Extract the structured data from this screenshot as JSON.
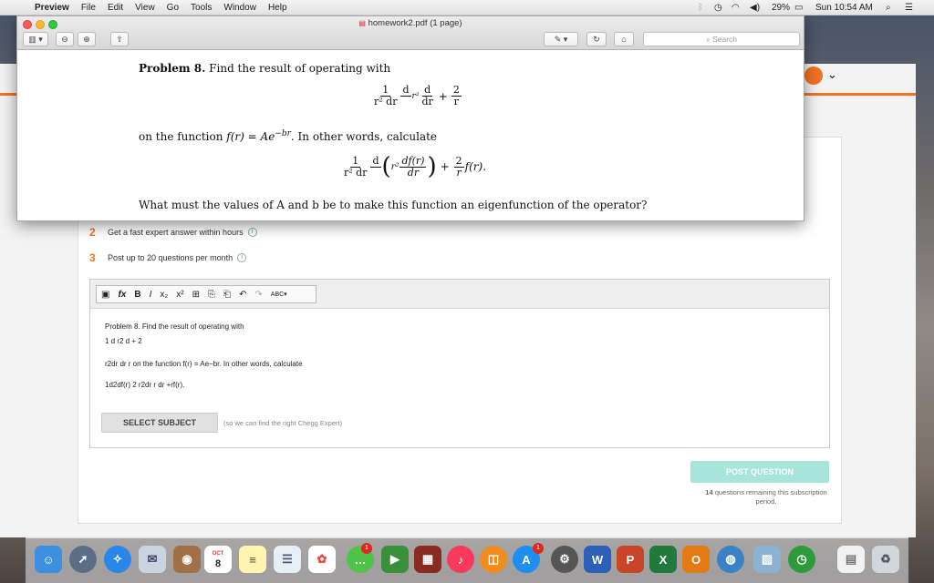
{
  "menubar": {
    "app": "Preview",
    "menus": [
      "File",
      "Edit",
      "View",
      "Go",
      "Tools",
      "Window",
      "Help"
    ],
    "battery": "29%",
    "clock": "Sun 10:54 AM"
  },
  "window": {
    "title": "homework2.pdf (1 page)",
    "search_placeholder": "Search"
  },
  "pdf": {
    "problem_label": "Problem 8.",
    "intro": "Find the result of operating with",
    "operator": {
      "a_num": "1",
      "a_den": "r² dr",
      "b_num": "d",
      "b_den": "",
      "r2": "r²",
      "c_num": "d",
      "c_den": "dr",
      "plus": "+",
      "d_num": "2",
      "d_den": "r"
    },
    "line2_prefix": "on the function",
    "function": "f(r) = Ae",
    "exponent": "−br",
    "line2_suffix": ". In other words, calculate",
    "calc": {
      "a_num": "1",
      "a_den": "r² dr",
      "b_num": "d",
      "open": "(",
      "r2": "r²",
      "c_num": "df(r)",
      "c_den": "dr",
      "close": ")",
      "plus": "+",
      "d_num": "2",
      "d_den": "r",
      "tail": "f(r)."
    },
    "question": "What must the values of A and b be to make this function an eigenfunction of the operator?"
  },
  "chegg": {
    "benefits": [
      {
        "num": "2",
        "text": "Get a fast expert answer within hours"
      },
      {
        "num": "3",
        "text": "Post up to 20 questions per month"
      }
    ],
    "toolbar_items": [
      "fx",
      "B",
      "I",
      "x₂",
      "x²",
      "⊞",
      "⎘",
      "⎗",
      "↶",
      "↷",
      "ABC▾"
    ],
    "editor_lines": [
      "Problem 8. Find the result of operating with",
      "1 d r2 d + 2",
      "r2dr dr r on the function f(r) = Ae−br. In other words, calculate",
      "1d2df(r) 2 r2dr r dr +rf(r)."
    ],
    "select_subject": "SELECT SUBJECT",
    "subject_hint": "(so we can find the right Chegg Expert)",
    "post_button": "POST QUESTION",
    "remaining_count": "14",
    "remaining_text": "questions remaining this subscription period."
  },
  "dock": {
    "calendar_month": "OCT",
    "calendar_day": "8",
    "badges": [
      "1",
      "1"
    ]
  },
  "colors": {
    "chegg_orange": "#f37121",
    "post_button": "#a7e5dc"
  }
}
